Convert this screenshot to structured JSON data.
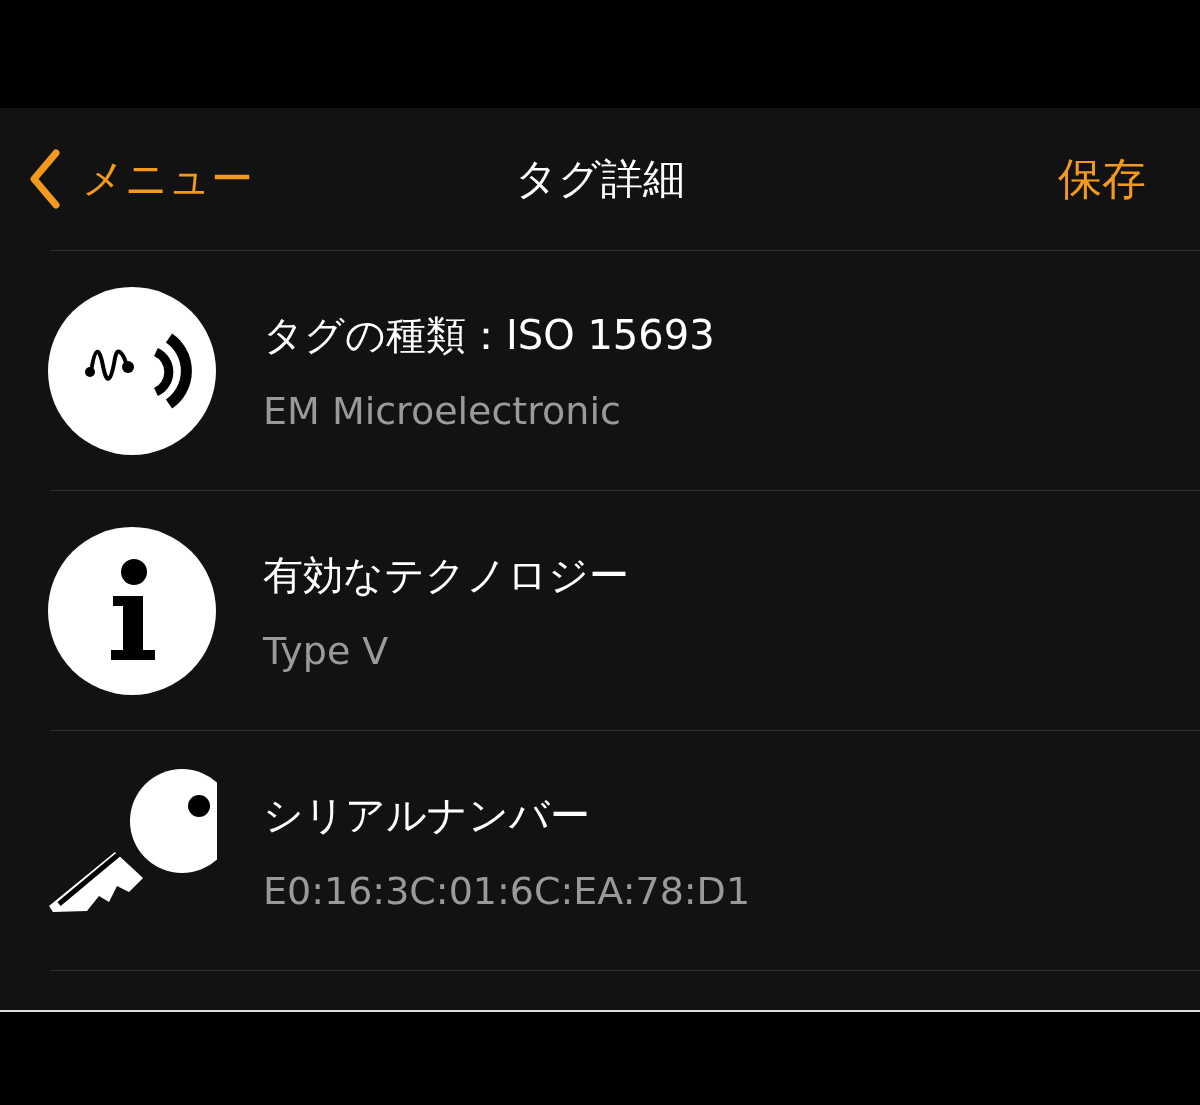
{
  "nav_bar": {
    "back_label": "メニュー",
    "title": "タグ詳細",
    "action": "保存"
  },
  "rows": [
    {
      "kind": "signal",
      "title": "タグの種類：ISO 15693",
      "value": "EM Microelectronic"
    },
    {
      "kind": "info",
      "title": "有効なテクノロジー",
      "value": "Type V"
    },
    {
      "kind": "key",
      "title": "シリアルナンバー",
      "value": "E0:16:3C:01:6C:EA:78:D1"
    }
  ]
}
